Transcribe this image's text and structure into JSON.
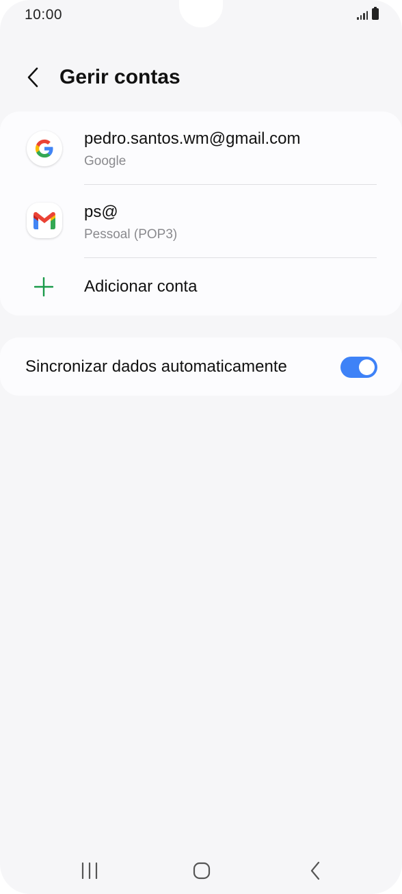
{
  "status_bar": {
    "time": "10:00",
    "icons": [
      "signal-icon",
      "battery-icon"
    ]
  },
  "header": {
    "title": "Gerir contas",
    "back_icon": "chevron-left-icon"
  },
  "accounts": [
    {
      "title": "pedro.santos.wm@gmail.com",
      "subtitle": "Google",
      "icon": "google-icon"
    },
    {
      "title": "ps@",
      "subtitle": "Pessoal (POP3)",
      "icon": "gmail-icon"
    }
  ],
  "add_account": {
    "label": "Adicionar conta",
    "icon": "plus-icon",
    "icon_color": "#1a9a4a"
  },
  "sync": {
    "label": "Sincronizar dados automaticamente",
    "enabled": true,
    "toggle_color": "#3e82f7"
  },
  "nav_bar": {
    "recents_icon": "recents-icon",
    "home_icon": "home-icon",
    "back_icon": "back-icon"
  }
}
